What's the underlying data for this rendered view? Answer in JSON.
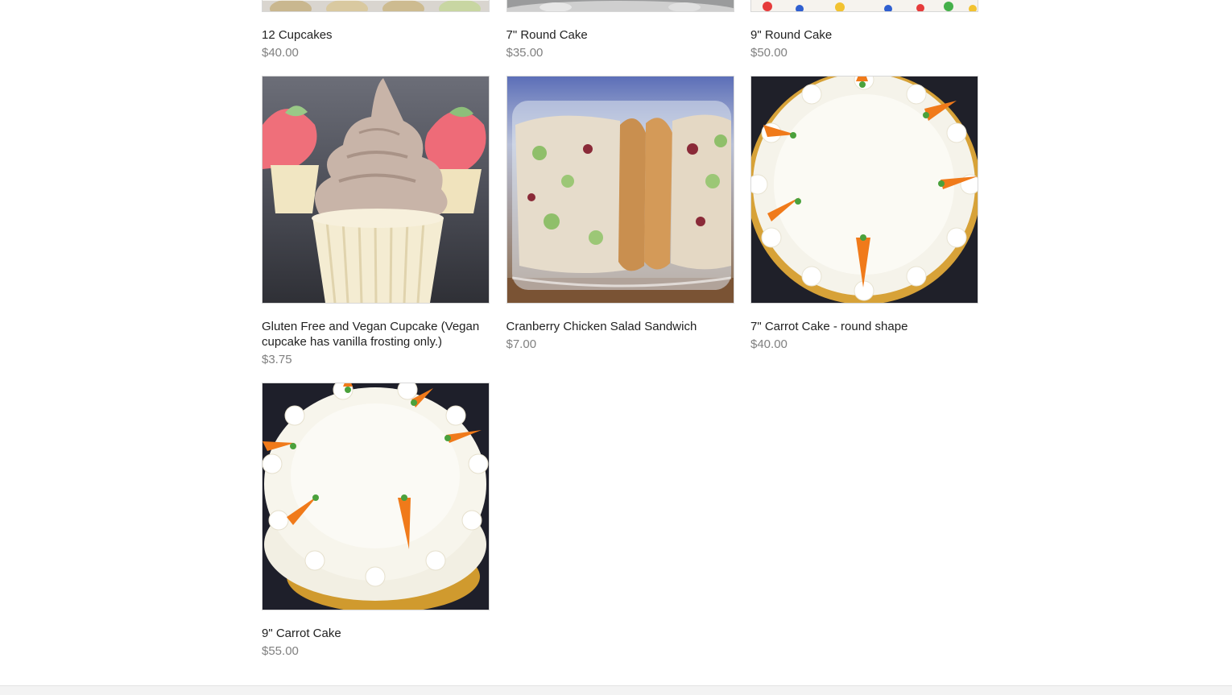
{
  "products": [
    {
      "name": "12 Cupcakes",
      "price": "$40.00",
      "image": "cupcakes-box-photo"
    },
    {
      "name": "7\" Round Cake",
      "price": "$35.00",
      "image": "round-cake-photo"
    },
    {
      "name": "9\" Round Cake",
      "price": "$50.00",
      "image": "polka-dot-cake-photo"
    },
    {
      "name": "Gluten Free and Vegan Cupcake (Vegan cupcake has vanilla frosting only.)",
      "price": "$3.75",
      "image": "vegan-cupcake-photo"
    },
    {
      "name": "Cranberry Chicken Salad Sandwich",
      "price": "$7.00",
      "image": "chicken-salad-sandwich-photo"
    },
    {
      "name": "7\" Carrot Cake - round shape",
      "price": "$40.00",
      "image": "carrot-cake-photo"
    },
    {
      "name": "9\" Carrot Cake",
      "price": "$55.00",
      "image": "carrot-cake-tall-photo"
    }
  ],
  "colors": {
    "name_text": "#222222",
    "price_text": "#808080",
    "border": "#d8d8d8",
    "footer": "#f3f3f3"
  }
}
